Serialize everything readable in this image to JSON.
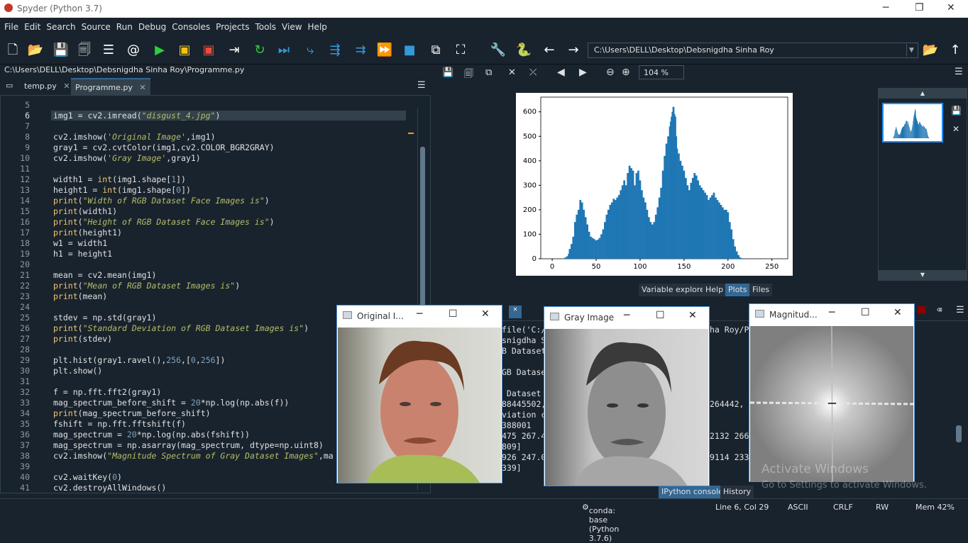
{
  "window": {
    "title": "Spyder (Python 3.7)"
  },
  "menu": [
    "File",
    "Edit",
    "Search",
    "Source",
    "Run",
    "Debug",
    "Consoles",
    "Projects",
    "Tools",
    "View",
    "Help"
  ],
  "toolbar": {
    "path": "C:\\Users\\DELL\\Desktop\\Debsnigdha Sinha Roy"
  },
  "editor": {
    "file_path": "C:\\Users\\DELL\\Desktop\\Debsnigdha Sinha Roy\\Programme.py",
    "tabs": [
      {
        "label": "temp.py"
      },
      {
        "label": "Programme.py"
      }
    ],
    "line_numbers": [
      "5",
      "6",
      "7",
      "8",
      "9",
      "10",
      "11",
      "12",
      "13",
      "14",
      "15",
      "16",
      "17",
      "18",
      "19",
      "20",
      "21",
      "22",
      "23",
      "24",
      "25",
      "26",
      "27",
      "28",
      "29",
      "30",
      "31",
      "32",
      "33",
      "34",
      "35",
      "36",
      "37",
      "38",
      "39",
      "40",
      "41"
    ]
  },
  "plots": {
    "zoom": "104 %",
    "tabs": [
      "Variable explorer",
      "Help",
      "Plots",
      "Files"
    ]
  },
  "chart_data": {
    "type": "bar",
    "title": "",
    "xlabel": "",
    "ylabel": "",
    "xlim": [
      -13,
      268
    ],
    "ylim": [
      0,
      660
    ],
    "xticks": [
      "0",
      "50",
      "100",
      "150",
      "200",
      "250"
    ],
    "yticks": [
      "0",
      "100",
      "200",
      "300",
      "400",
      "500",
      "600"
    ],
    "color": "#1f77b4",
    "x": [
      15,
      17,
      19,
      20,
      22,
      24,
      26,
      28,
      30,
      32,
      34,
      36,
      38,
      40,
      42,
      44,
      46,
      48,
      50,
      52,
      54,
      56,
      58,
      60,
      62,
      64,
      66,
      68,
      70,
      72,
      74,
      76,
      78,
      80,
      82,
      84,
      86,
      88,
      90,
      92,
      94,
      96,
      98,
      100,
      102,
      104,
      106,
      108,
      110,
      112,
      114,
      116,
      118,
      120,
      122,
      124,
      126,
      128,
      130,
      132,
      134,
      135,
      136,
      137,
      138,
      139,
      140,
      141,
      142,
      144,
      146,
      148,
      150,
      152,
      154,
      156,
      158,
      160,
      162,
      164,
      166,
      168,
      170,
      172,
      174,
      176,
      178,
      180,
      182,
      184,
      186,
      188,
      190,
      192,
      194,
      196,
      198,
      200,
      202,
      204,
      206,
      208,
      210,
      212,
      214,
      216
    ],
    "values": [
      5,
      10,
      20,
      40,
      60,
      90,
      150,
      180,
      200,
      240,
      230,
      200,
      170,
      140,
      110,
      90,
      85,
      80,
      75,
      78,
      85,
      100,
      120,
      150,
      180,
      200,
      220,
      230,
      245,
      240,
      250,
      260,
      280,
      300,
      320,
      300,
      350,
      380,
      370,
      360,
      300,
      350,
      360,
      320,
      280,
      250,
      230,
      200,
      170,
      150,
      140,
      150,
      180,
      210,
      250,
      290,
      360,
      420,
      470,
      500,
      540,
      560,
      580,
      600,
      620,
      590,
      580,
      500,
      450,
      430,
      400,
      380,
      360,
      330,
      300,
      280,
      310,
      330,
      350,
      340,
      320,
      300,
      290,
      280,
      270,
      260,
      240,
      250,
      260,
      270,
      250,
      240,
      230,
      220,
      210,
      200,
      200,
      190,
      150,
      120,
      80,
      50,
      30,
      15,
      5,
      2
    ]
  },
  "console": {
    "lines": [
      "file('C:/",
      "snigdha S",
      "B Dataset",
      "",
      "GB Datase",
      "",
      " Dataset",
      "88445502,",
      "viation c",
      "388001",
      "475 267.4",
      "809]",
      "926 247.0",
      "339]"
    ],
    "right_lines": [
      "ha Roy/P",
      "",
      "",
      "",
      "",
      "",
      "",
      "264442,",
      "",
      "",
      "2132 266",
      "",
      "9114 233",
      ""
    ],
    "tabs": [
      "IPython console",
      "History"
    ]
  },
  "windows": [
    {
      "title": "Original I..."
    },
    {
      "title": "Gray Image"
    },
    {
      "title": "Magnitud..."
    }
  ],
  "watermark": {
    "line1": "Activate Windows",
    "line2": "Go to Settings to activate Windows."
  },
  "status": {
    "env": "conda: base (Python 3.7.6)",
    "cursor": "Line 6, Col 29",
    "encoding": "ASCII",
    "eol": "CRLF",
    "rw": "RW",
    "mem": "Mem 42%"
  }
}
